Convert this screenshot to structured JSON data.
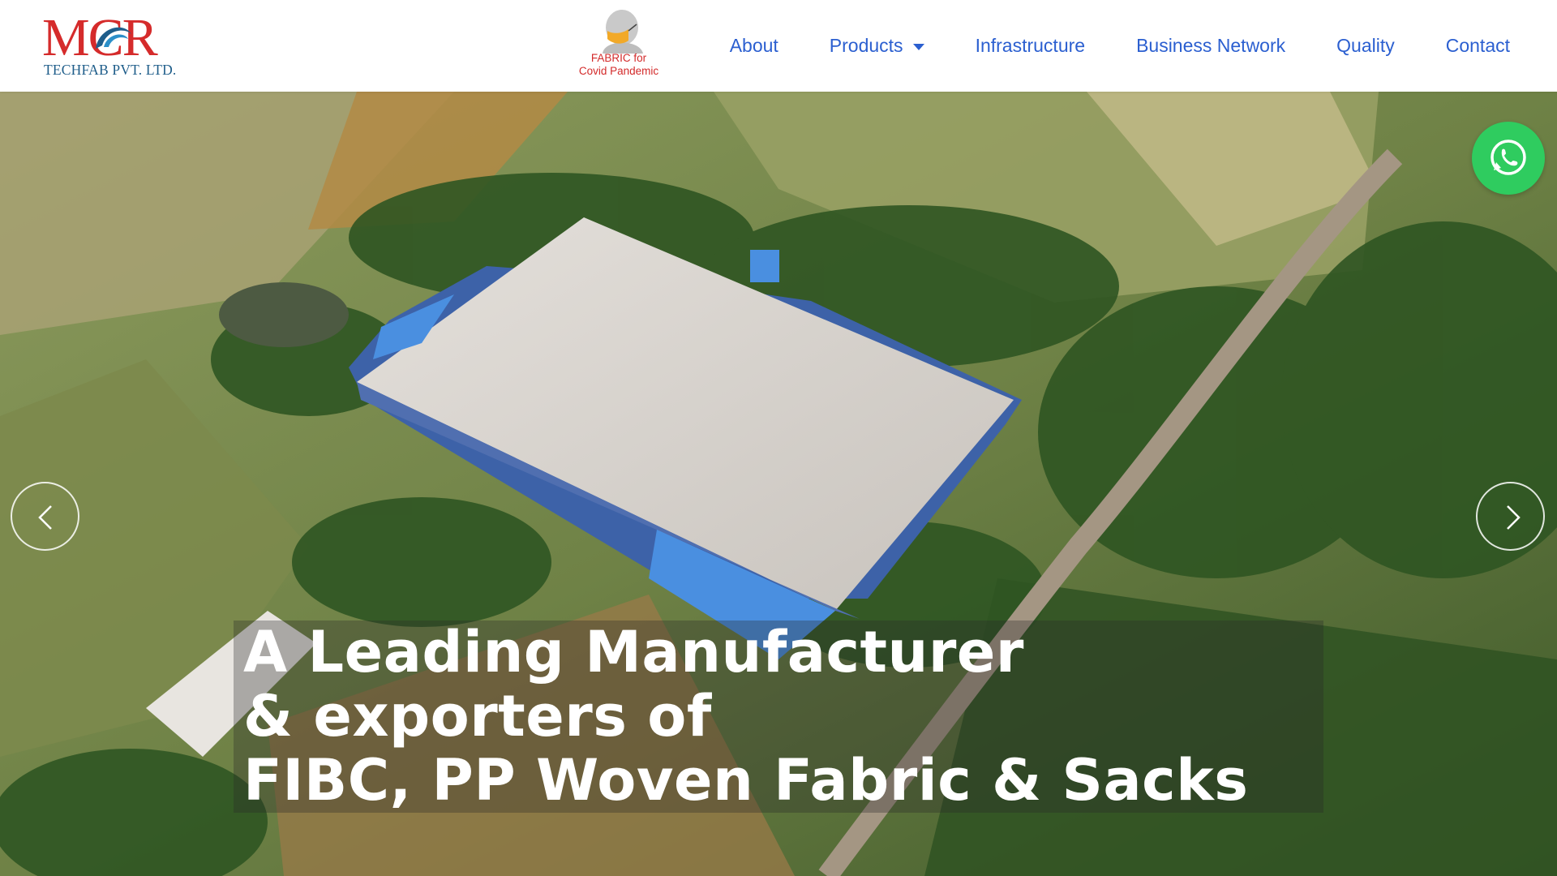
{
  "brand": {
    "logo_main": "MCR",
    "logo_sub": "TECHFAB PVT. LTD.",
    "color_red": "#d52b2b",
    "color_blue": "#1e5d8a"
  },
  "covid_badge": {
    "line1": "FABRIC for",
    "line2": "Covid Pandemic",
    "icon": "masked-person-icon"
  },
  "nav": {
    "color": "#2b5fd0",
    "items": [
      {
        "label": "About"
      },
      {
        "label": "Products",
        "has_dropdown": true
      },
      {
        "label": "Infrastructure"
      },
      {
        "label": "Business Network"
      },
      {
        "label": "Quality"
      },
      {
        "label": "Contact"
      }
    ]
  },
  "hero": {
    "headline": [
      "A Leading Manufacturer",
      "& exporters of",
      "FIBC, PP Woven Fabric & Sacks"
    ],
    "prev_icon": "chevron-left-icon",
    "next_icon": "chevron-right-icon"
  },
  "whatsapp": {
    "icon": "whatsapp-icon",
    "color": "#2fcc5f"
  }
}
